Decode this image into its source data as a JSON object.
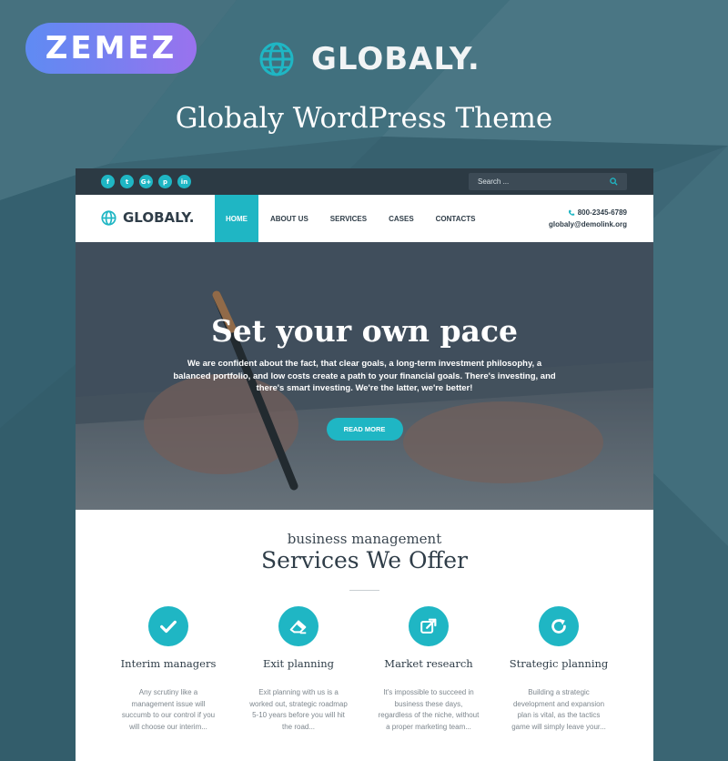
{
  "promo": {
    "vendor_label": "ZEMEZ",
    "brand_name": "GLOBALY.",
    "title": "Globaly WordPress Theme"
  },
  "site": {
    "topbar": {
      "social_icons": [
        {
          "name": "facebook-icon",
          "glyph": "f"
        },
        {
          "name": "twitter-icon",
          "glyph": "t"
        },
        {
          "name": "google-plus-icon",
          "glyph": "G+"
        },
        {
          "name": "pinterest-icon",
          "glyph": "p"
        },
        {
          "name": "linkedin-icon",
          "glyph": "in"
        }
      ],
      "search_placeholder": "Search ..."
    },
    "logo_text": "GLOBALY.",
    "nav": [
      "HOME",
      "ABOUT US",
      "SERVICES",
      "CASES",
      "CONTACTS"
    ],
    "active_nav": "HOME",
    "contact": {
      "phone": "800-2345-6789",
      "email": "globaly@demolink.org"
    },
    "hero": {
      "title": "Set your own pace",
      "text": "We are confident about the fact, that clear goals, a long-term investment philosophy, a balanced portfolio, and low costs create a path to your financial goals. There's investing, and there's smart investing. We're the latter, we're better!",
      "button": "READ MORE"
    },
    "services": {
      "subtitle": "business management",
      "heading": "Services We Offer",
      "items": [
        {
          "icon": "check-icon",
          "title": "Interim managers",
          "desc": "Any scrutiny like a management issue will succumb to our control if you will choose our interim..."
        },
        {
          "icon": "eraser-icon",
          "title": "Exit planning",
          "desc": "Exit planning with us is a worked out, strategic roadmap 5-10 years before you will hit the road..."
        },
        {
          "icon": "external-link-icon",
          "title": "Market research",
          "desc": "It's impossible to succeed in business these days, regardless of the niche, without a proper marketing team..."
        },
        {
          "icon": "refresh-icon",
          "title": "Strategic planning",
          "desc": "Building a strategic development and expansion plan is vital, as the tactics game will simply leave your..."
        }
      ]
    }
  },
  "colors": {
    "accent": "#1fb6c4",
    "dark": "#2c3a44",
    "background": "#3b6675"
  }
}
